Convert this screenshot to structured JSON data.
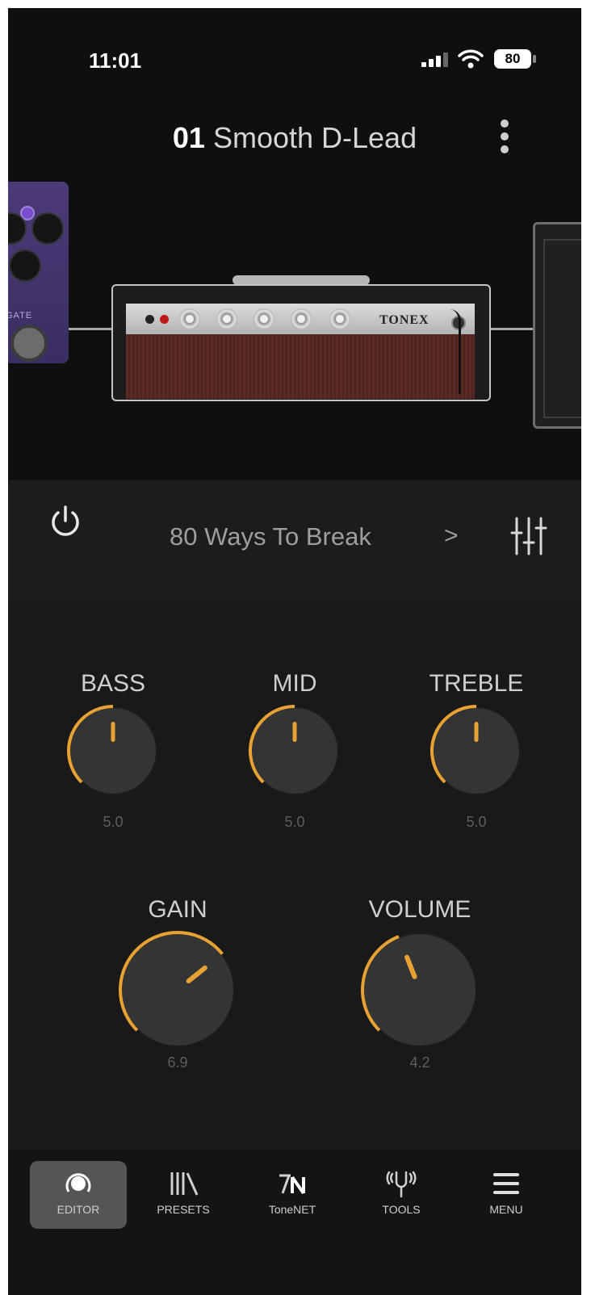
{
  "status": {
    "time": "11:01",
    "battery": "80"
  },
  "header": {
    "preset_number": "01",
    "preset_name": "Smooth D-Lead"
  },
  "chain": {
    "pedal_label": "GATE",
    "amp_brand": "TONEX"
  },
  "model": {
    "name": "80 Ways To Break",
    "chevron": ">"
  },
  "knobs": [
    {
      "label": "BASS",
      "value": "5.0"
    },
    {
      "label": "MID",
      "value": "5.0"
    },
    {
      "label": "TREBLE",
      "value": "5.0"
    },
    {
      "label": "GAIN",
      "value": "6.9"
    },
    {
      "label": "VOLUME",
      "value": "4.2"
    }
  ],
  "tabs": [
    {
      "label": "EDITOR",
      "icon": "editor-knob-icon",
      "active": true
    },
    {
      "label": "PRESETS",
      "icon": "presets-library-icon"
    },
    {
      "label": "ToneNET",
      "icon": "tonenet-logo-icon"
    },
    {
      "label": "TOOLS",
      "icon": "tuning-fork-icon"
    },
    {
      "label": "MENU",
      "icon": "hamburger-menu-icon"
    }
  ],
  "colors": {
    "accent": "#e7a233",
    "background": "#191919",
    "stage": "#0f0f10"
  }
}
